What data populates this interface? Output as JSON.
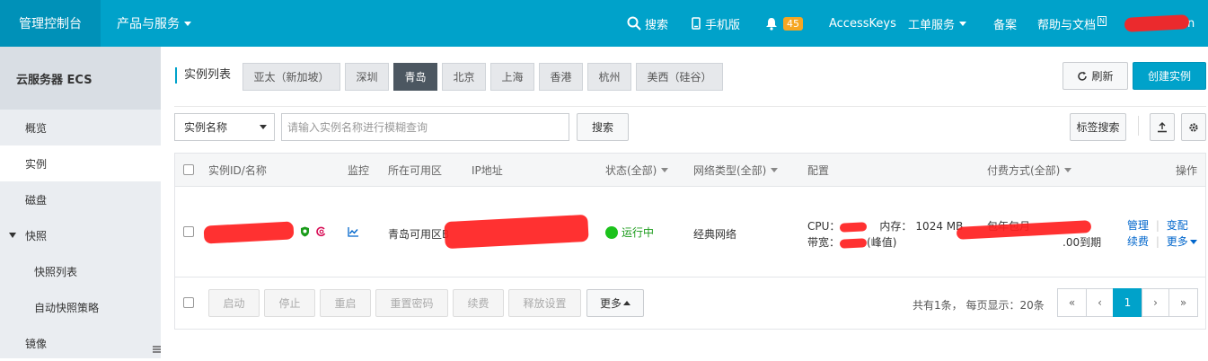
{
  "topbar": {
    "home": "管理控制台",
    "products": "产品与服务",
    "search": "搜索",
    "mobile": "手机版",
    "notifications_count": "45",
    "access_keys": "AccessKeys",
    "tickets": "工单服务",
    "beian": "备案",
    "help": "帮助与文档",
    "help_badge": "N",
    "user_suffix": "n"
  },
  "sidebar": {
    "title": "云服务器 ECS",
    "items": [
      {
        "label": "概览"
      },
      {
        "label": "实例"
      },
      {
        "label": "磁盘"
      },
      {
        "label": "快照"
      },
      {
        "label": "快照列表"
      },
      {
        "label": "自动快照策略"
      },
      {
        "label": "镜像"
      }
    ]
  },
  "regions": {
    "label": "实例列表",
    "tabs": [
      "亚太（新加坡）",
      "深圳",
      "青岛",
      "北京",
      "上海",
      "香港",
      "杭州",
      "美西（硅谷）"
    ],
    "active": "青岛"
  },
  "actions": {
    "refresh": "刷新",
    "create": "创建实例",
    "tag_search": "标签搜索"
  },
  "search": {
    "select_value": "实例名称",
    "placeholder": "请输入实例名称进行模糊查询",
    "button": "搜索"
  },
  "table": {
    "headers": {
      "id": "实例ID/名称",
      "monitor": "监控",
      "zone": "所在可用区",
      "ip": "IP地址",
      "status": "状态(全部)",
      "network": "网络类型(全部)",
      "config": "配置",
      "billing": "付费方式(全部)",
      "ops": "操作"
    },
    "row": {
      "zone": "青岛可用区B",
      "status": "运行中",
      "network": "经典网络",
      "cpu_label": "CPU：",
      "mem_label": "内存：",
      "mem_value": "1024 MB",
      "bandwidth_label": "带宽：",
      "bandwidth_suffix": "(峰值)",
      "billing_type": "包年包月",
      "expiry_suffix": ".00到期",
      "op_manage": "管理",
      "op_change": "变配",
      "op_renew": "续费",
      "op_more": "更多"
    }
  },
  "footer": {
    "buttons": [
      "启动",
      "停止",
      "重启",
      "重置密码",
      "续费",
      "释放设置"
    ],
    "more": "更多",
    "summary": "共有1条， 每页显示：20条",
    "pager": [
      "«",
      "‹",
      "1",
      "›",
      "»"
    ]
  }
}
